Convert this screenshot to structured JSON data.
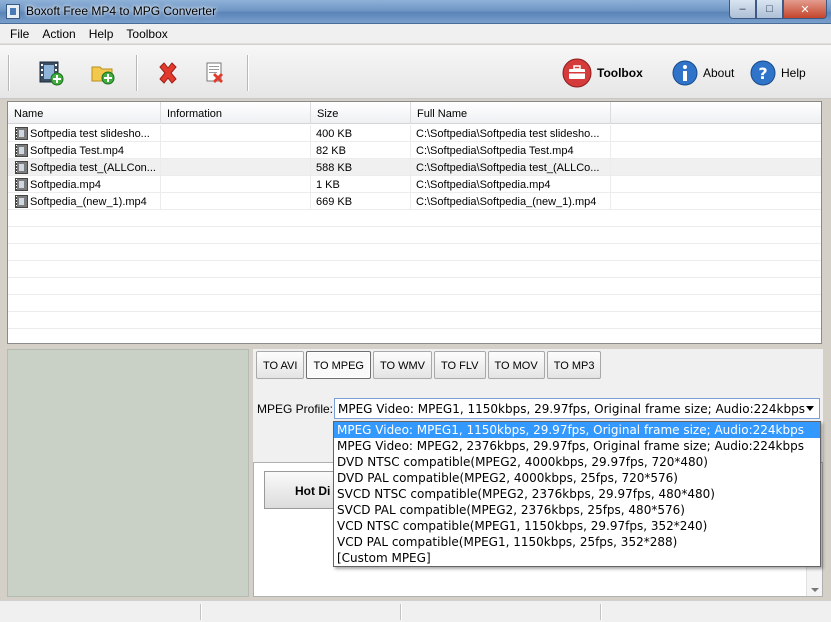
{
  "window": {
    "title": "Boxoft Free MP4 to MPG Converter"
  },
  "menu": [
    "File",
    "Action",
    "Help",
    "Toolbox"
  ],
  "toolbar": {
    "toolbox": "Toolbox",
    "about": "About",
    "help": "Help"
  },
  "list": {
    "columns": [
      "Name",
      "Information",
      "Size",
      "Full Name"
    ],
    "rows": [
      {
        "name": "Softpedia test slidesho...",
        "info": "",
        "size": "400 KB",
        "full": "C:\\Softpedia\\Softpedia test slidesho..."
      },
      {
        "name": "Softpedia Test.mp4",
        "info": "",
        "size": "82 KB",
        "full": "C:\\Softpedia\\Softpedia Test.mp4"
      },
      {
        "name": "Softpedia test_(ALLCon...",
        "info": "",
        "size": "588 KB",
        "full": "C:\\Softpedia\\Softpedia test_(ALLCo..."
      },
      {
        "name": "Softpedia.mp4",
        "info": "",
        "size": "1 KB",
        "full": "C:\\Softpedia\\Softpedia.mp4"
      },
      {
        "name": "Softpedia_(new_1).mp4",
        "info": "",
        "size": "669 KB",
        "full": "C:\\Softpedia\\Softpedia_(new_1).mp4"
      }
    ]
  },
  "tabs": [
    "TO AVI",
    "TO MPEG",
    "TO WMV",
    "TO FLV",
    "TO MOV",
    "TO MP3"
  ],
  "profile": {
    "label": "MPEG Profile:",
    "selected": "MPEG Video: MPEG1, 1150kbps, 29.97fps, Original frame size; Audio:224kbps",
    "options": [
      "MPEG Video: MPEG1, 1150kbps, 29.97fps, Original frame size; Audio:224kbps",
      "MPEG Video: MPEG2, 2376kbps, 29.97fps, Original frame size; Audio:224kbps",
      "DVD NTSC compatible(MPEG2, 4000kbps, 29.97fps, 720*480)",
      "DVD PAL compatible(MPEG2, 4000kbps, 25fps, 720*576)",
      "SVCD NTSC compatible(MPEG2, 2376kbps, 29.97fps, 480*480)",
      "SVCD PAL compatible(MPEG2, 2376kbps, 25fps, 480*576)",
      "VCD NTSC compatible(MPEG1, 1150kbps, 29.97fps, 352*240)",
      "VCD PAL compatible(MPEG1, 1150kbps, 25fps, 352*288)",
      "[Custom MPEG]"
    ]
  },
  "hot_directory": {
    "label": "Hot Di"
  },
  "colors": {
    "selection": "#3399ff",
    "left_panel": "#c9d1c7",
    "toolbox_icon": "#d63b3b",
    "info_icon": "#2f74c9"
  }
}
